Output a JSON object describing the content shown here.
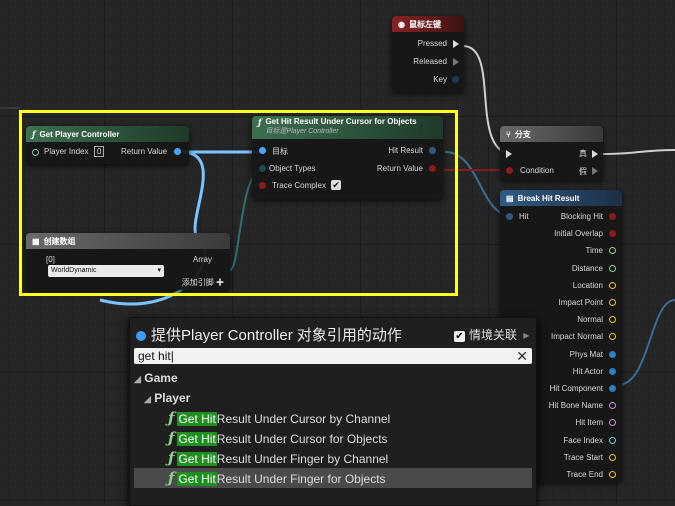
{
  "nodes": {
    "mouse": {
      "title": "鼠标左键",
      "pressed": "Pressed",
      "released": "Released",
      "key": "Key"
    },
    "get_pc": {
      "title": "Get Player Controller",
      "player_index_label": "Player Index",
      "player_index_value": "0",
      "return_value": "Return Value"
    },
    "hit_result": {
      "title": "Get Hit Result Under Cursor for Objects",
      "subtitle": "目标是Player Controller",
      "target": "目标",
      "object_types": "Object Types",
      "trace_complex": "Trace Complex",
      "hit": "Hit Result",
      "return_value": "Return Value"
    },
    "make_array": {
      "title": "创建数组",
      "index0": "[0]",
      "value0": "WorldDynamic",
      "array": "Array",
      "add_pin": "添加引脚 ✚"
    },
    "branch": {
      "title": "分支",
      "condition": "Condition",
      "true_label": "真",
      "false_label": "假"
    },
    "break_hit": {
      "title": "Break Hit Result",
      "hit": "Hit",
      "outputs": [
        "Blocking Hit",
        "Initial Overlap",
        "Time",
        "Distance",
        "Location",
        "Impact Point",
        "Normal",
        "Impact Normal",
        "Phys Mat",
        "Hit Actor",
        "Hit Component",
        "Hit Bone Name",
        "Hit Item",
        "Face Index",
        "Trace Start",
        "Trace End"
      ]
    }
  },
  "popup": {
    "title": "提供Player Controller 对象引用的动作",
    "context_label": "情境关联",
    "context_checked": "✔",
    "search_value": "get hit",
    "categories": {
      "game": "Game",
      "player": "Player"
    },
    "items": [
      {
        "match": "Get Hit",
        "rest": "Result Under Cursor by Channel"
      },
      {
        "match": "Get Hit",
        "rest": "Result Under Cursor for Objects"
      },
      {
        "match": "Get Hit",
        "rest": "Result Under Finger by Channel"
      },
      {
        "match": "Get Hit",
        "rest": "Result Under Finger for Objects"
      }
    ]
  }
}
